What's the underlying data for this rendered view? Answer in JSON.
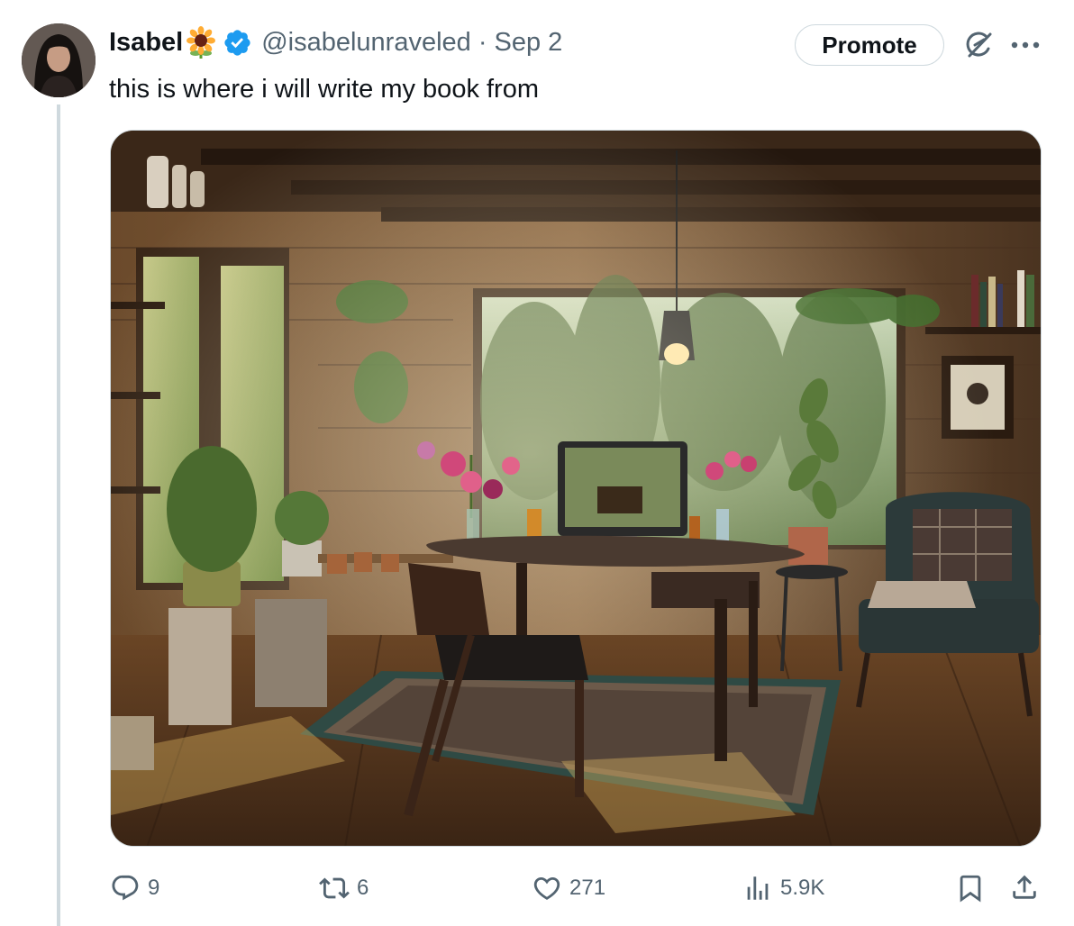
{
  "tweet": {
    "author": {
      "display_name": "Isabel",
      "name_emoji": "sunflower-emoji",
      "verified_icon": "verified-badge-icon",
      "handle": "@isabelunraveled",
      "separator": "·",
      "date": "Sep 2"
    },
    "text": "this is where i will write my book from",
    "promote_label": "Promote",
    "media": {
      "alt": "Sunlit wooden cabin room with a desk and computer in front of a large window, plants, flowers, a rug and an armchair"
    },
    "actions": {
      "replies": "9",
      "reposts": "6",
      "likes": "271",
      "views": "5.9K"
    }
  },
  "icons": {
    "grok": "grok-icon",
    "more": "more-icon",
    "reply": "reply-icon",
    "repost": "repost-icon",
    "like": "heart-icon",
    "views": "views-icon",
    "bookmark": "bookmark-icon",
    "share": "share-icon"
  },
  "colors": {
    "verified": "#1d9bf0",
    "secondary_text": "#536471",
    "primary_text": "#0f1419",
    "border": "#cfd9de"
  }
}
